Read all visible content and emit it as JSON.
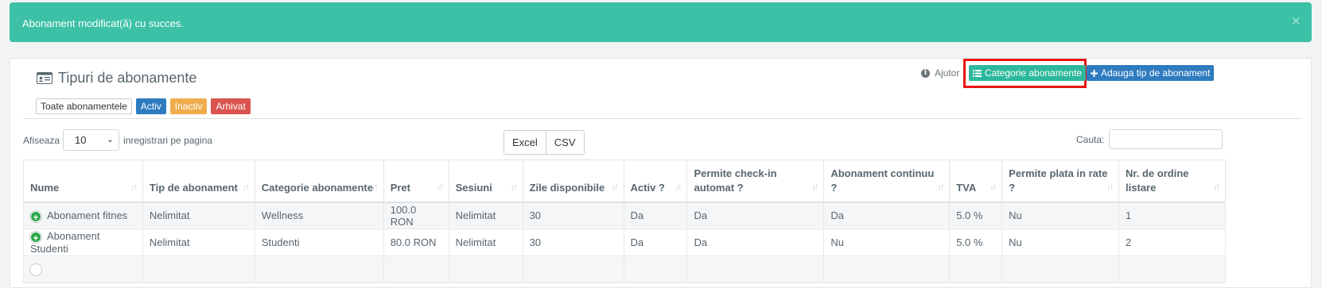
{
  "alert": {
    "message": "Abonament modificat(ă) cu succes.",
    "close": "×"
  },
  "panel": {
    "title": "Tipuri de abonamente",
    "filters": {
      "all": "Toate abonamentele",
      "active": "Activ",
      "inactive": "Inactiv",
      "archived": "Arhivat"
    },
    "help": "Ajutor",
    "buttons": {
      "categories": "Categorie abonamente",
      "add": "Adauga tip de abonament"
    }
  },
  "table_controls": {
    "show_label": "Afiseaza",
    "page_size": "10",
    "per_page_label": "inregistrari pe pagina",
    "export": {
      "excel": "Excel",
      "csv": "CSV"
    },
    "search_label": "Cauta:",
    "search_value": ""
  },
  "table": {
    "headers": [
      "Nume",
      "Tip de abonament",
      "Categorie abonamente",
      "Pret",
      "Sesiuni",
      "Zile disponibile",
      "Activ ?",
      "Permite check-in automat ?",
      "Abonament continuu ?",
      "TVA",
      "Permite plata in rate ?",
      "Nr. de ordine listare"
    ],
    "rows": [
      [
        "Abonament fitnes",
        "Nelimitat",
        "Wellness",
        "100.0 RON",
        "Nelimitat",
        "30",
        "Da",
        "Da",
        "Da",
        "5.0 %",
        "Nu",
        "1"
      ],
      [
        "Abonament Studenti",
        "Nelimitat",
        "Studenti",
        "80.0 RON",
        "Nelimitat",
        "30",
        "Da",
        "Da",
        "Nu",
        "5.0 %",
        "Nu",
        "2"
      ],
      [
        "",
        "",
        "",
        "",
        "",
        "",
        "",
        "",
        "",
        "",
        "",
        ""
      ]
    ]
  },
  "colors": {
    "alert": "#3cc0a6",
    "primary": "#2f7bbf",
    "success": "#2db89d",
    "warning": "#f0ad4e",
    "danger": "#d9534f",
    "highlight": "#e81414"
  }
}
